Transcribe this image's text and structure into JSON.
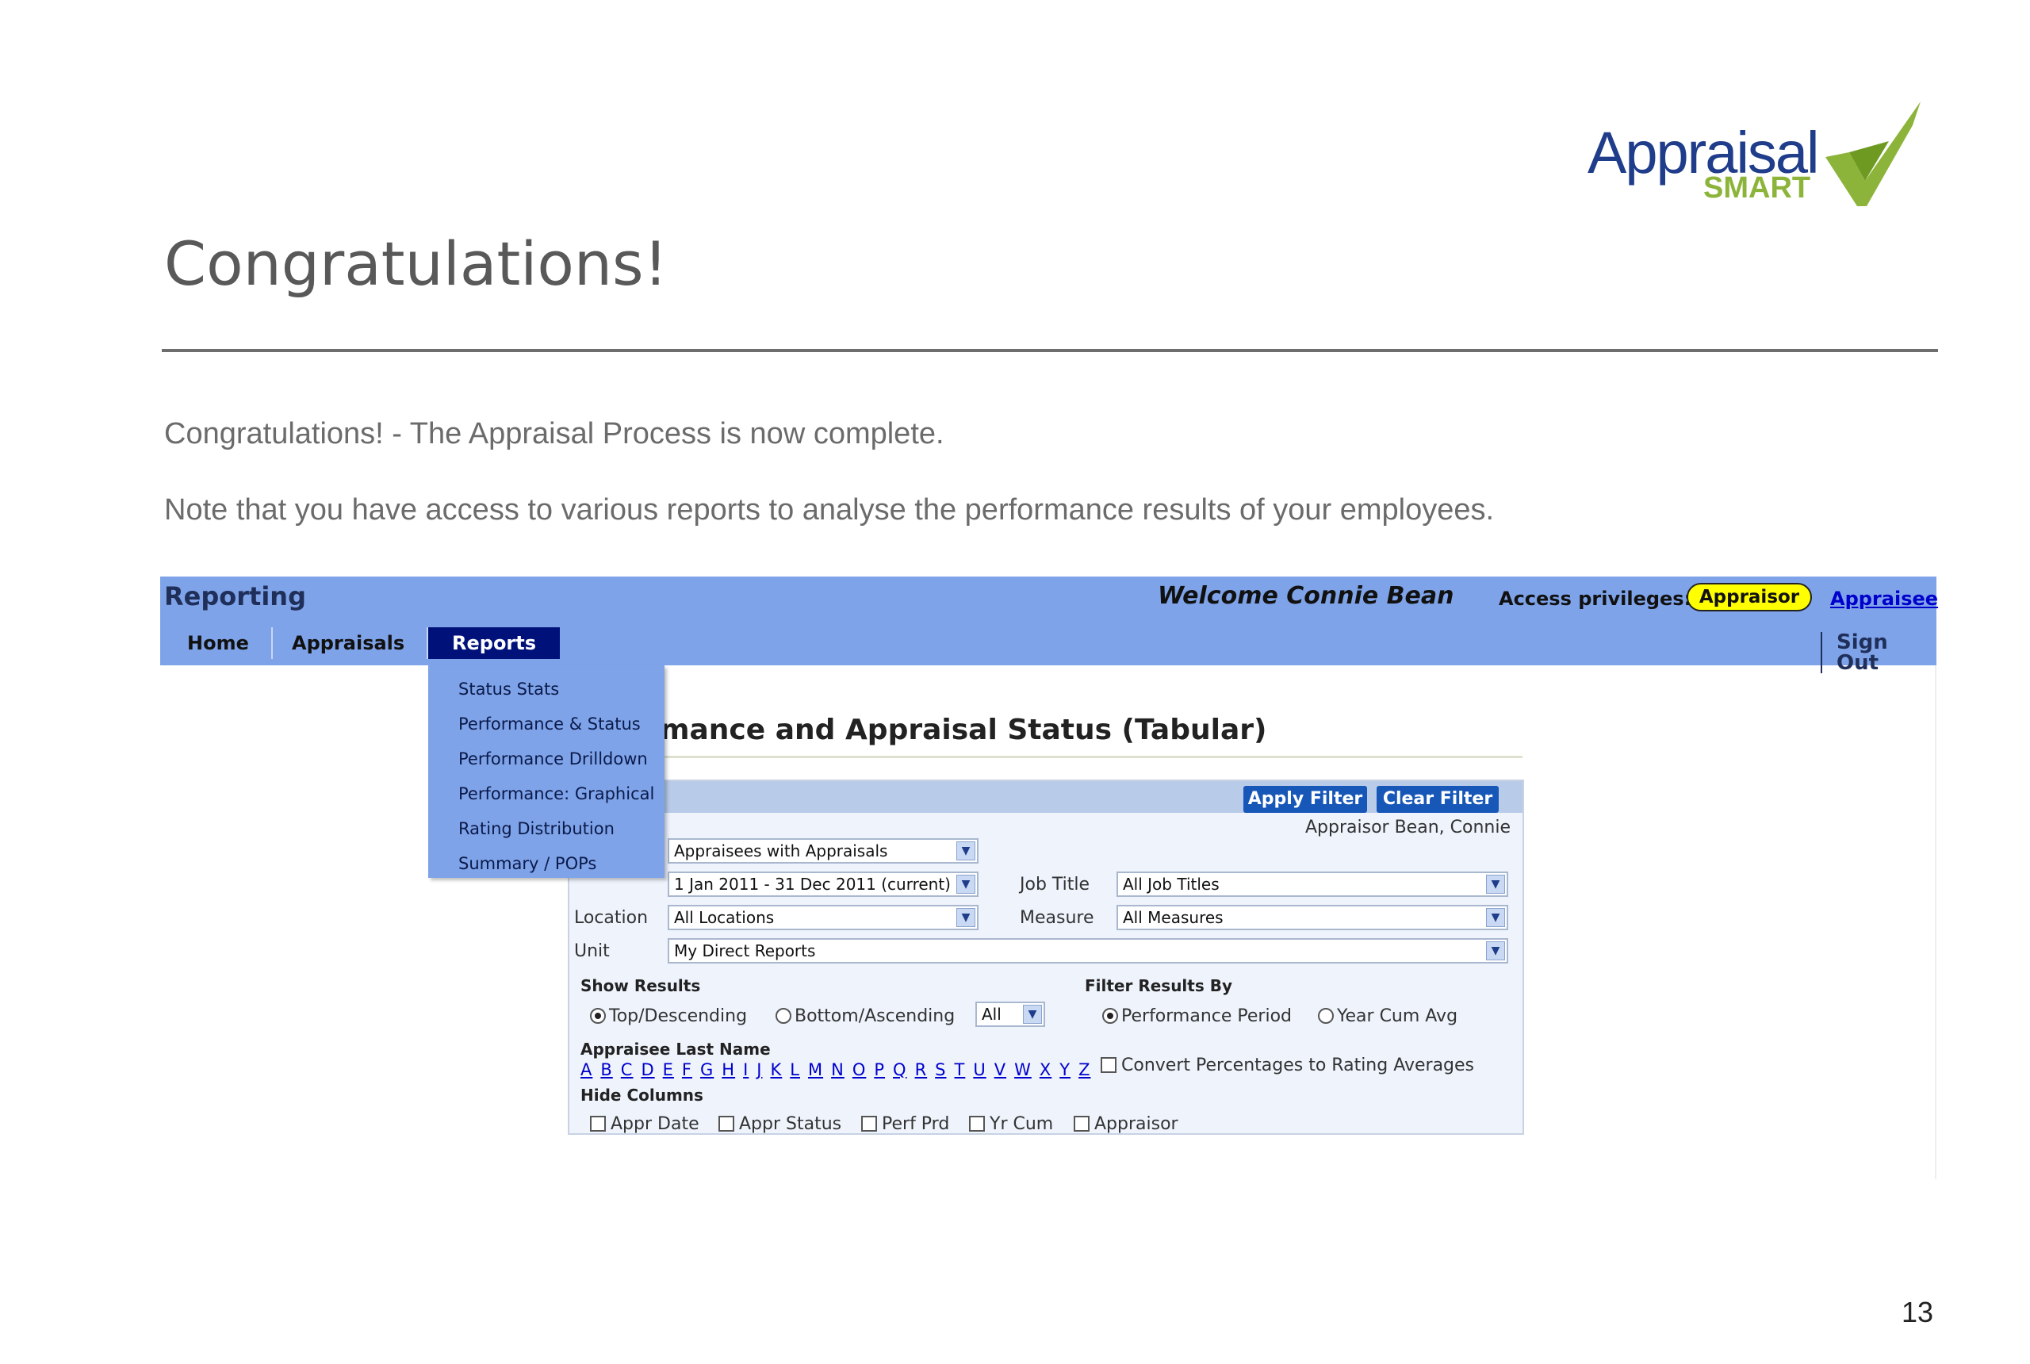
{
  "slide": {
    "title": "Congratulations!",
    "line1": "Congratulations! - The Appraisal Process is now complete.",
    "line2": "Note that you have access to various reports to analyse the performance results of your employees.",
    "page_number": "13",
    "logo": {
      "word1": "Appraisal",
      "word2": "SMART",
      "brand_blue": "#1f3d8a",
      "brand_green": "#8db43a"
    }
  },
  "app": {
    "section_title": "Reporting",
    "welcome": "Welcome Connie Bean",
    "access_label": "Access privileges:",
    "access_badge": "Appraisor",
    "appraisee_link": "Appraisee",
    "sign_out": "Sign Out",
    "nav": [
      "Home",
      "Appraisals",
      "Reports"
    ],
    "reports_menu": [
      "Status Stats",
      "Performance & Status",
      "Performance Drilldown",
      "Performance: Graphical",
      "Rating Distribution",
      "Summary / POPs"
    ],
    "page_heading": "mance and Appraisal Status (Tabular)",
    "filter": {
      "apply": "Apply Filter",
      "clear": "Clear Filter",
      "appraisor": "Appraisor Bean, Connie",
      "appraisees_select": "Appraisees with Appraisals",
      "period_select": "1 Jan 2011 - 31 Dec 2011 (current)",
      "job_title_label": "Job Title",
      "job_title_select": "All Job Titles",
      "location_label": "Location",
      "location_select": "All Locations",
      "measure_label": "Measure",
      "measure_select": "All Measures",
      "unit_label": "Unit",
      "unit_select": "My Direct Reports",
      "show_results_label": "Show Results",
      "top_desc": "Top/Descending",
      "bottom_asc": "Bottom/Ascending",
      "count_select": "All",
      "filter_by_label": "Filter Results By",
      "perf_period": "Performance Period",
      "year_cum": "Year Cum Avg",
      "last_name_label": "Appraisee Last Name",
      "letters": [
        "A",
        "B",
        "C",
        "D",
        "E",
        "F",
        "G",
        "H",
        "I",
        "J",
        "K",
        "L",
        "M",
        "N",
        "O",
        "P",
        "Q",
        "R",
        "S",
        "T",
        "U",
        "V",
        "W",
        "X",
        "Y",
        "Z"
      ],
      "convert_pct": "Convert Percentages to Rating Averages",
      "hide_columns_label": "Hide Columns",
      "hide_columns": [
        "Appr Date",
        "Appr Status",
        "Perf Prd",
        "Yr Cum",
        "Appraisor"
      ]
    },
    "colors": {
      "bar": "#7ea3e8",
      "active_tab": "#00127a",
      "button": "#1757b8",
      "badge": "#ffff00"
    }
  }
}
